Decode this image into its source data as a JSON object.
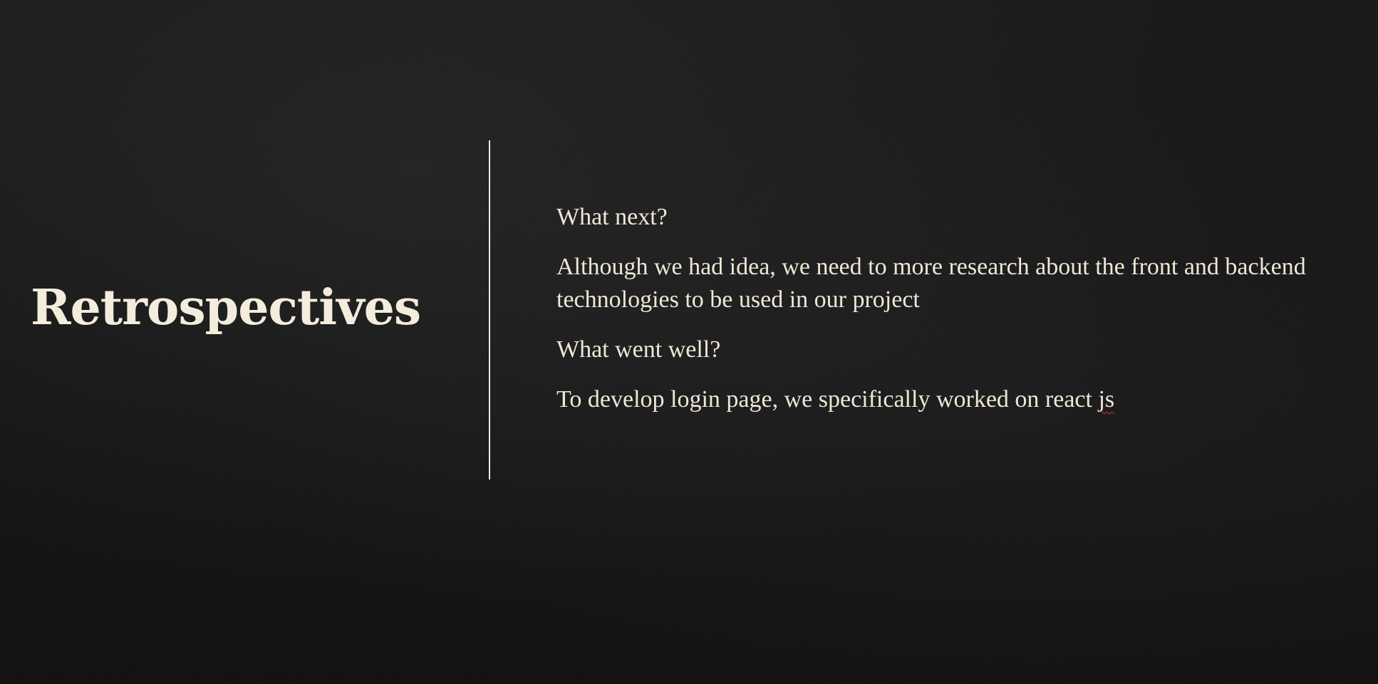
{
  "slide": {
    "title": "Retrospectives",
    "paragraphs": [
      "What next?",
      "Although we had idea, we need to more research  about the front and backend technologies to be used in our project",
      "What went well?"
    ],
    "last_paragraph_prefix": "To develop login page, we specifically worked on react ",
    "last_paragraph_misspelled": "js"
  },
  "colors": {
    "background": "#141414",
    "text": "#efe7d7",
    "divider": "#f1eadb",
    "spellcheck_underline": "#d9342b"
  }
}
